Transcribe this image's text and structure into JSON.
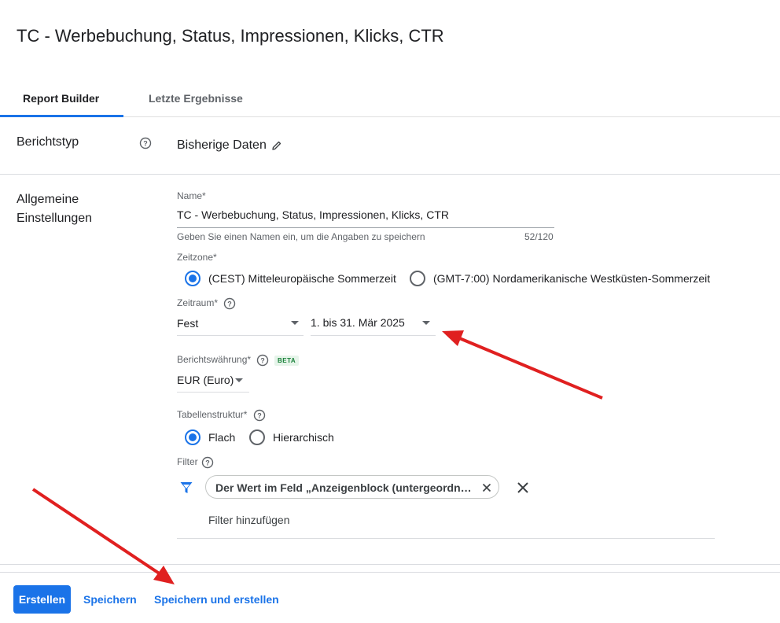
{
  "report": {
    "title": "TC - Werbebuchung, Status, Impressionen, Klicks, CTR"
  },
  "tabs": [
    {
      "label": "Report Builder",
      "active": true
    },
    {
      "label": "Letzte Ergebnisse",
      "active": false
    }
  ],
  "report_type": {
    "section_label": "Berichtstyp",
    "value": "Bisherige Daten",
    "help_icon": "help-circle-icon",
    "edit_icon": "pencil-icon"
  },
  "general": {
    "section_label_line1": "Allgemeine",
    "section_label_line2": "Einstellungen",
    "name": {
      "label": "Name*",
      "value": "TC - Werbebuchung, Status, Impressionen, Klicks, CTR",
      "hint": "Geben Sie einen Namen ein, um die Angaben zu speichern",
      "counter": "52/120"
    },
    "timezone": {
      "label": "Zeitzone*",
      "options": [
        {
          "label": "(CEST) Mitteleuropäische Sommerzeit",
          "selected": true
        },
        {
          "label": "(GMT-7:00) Nordamerikanische Westküsten-Sommerzeit",
          "selected": false
        }
      ]
    },
    "period": {
      "label": "Zeitraum*",
      "type_value": "Fest",
      "range_value": "1. bis 31. Mär 2025"
    },
    "currency": {
      "label": "Berichtswährung*",
      "badge": "BETA",
      "value": "EUR (Euro)"
    },
    "table_structure": {
      "label": "Tabellenstruktur*",
      "options": [
        {
          "label": "Flach",
          "selected": true
        },
        {
          "label": "Hierarchisch",
          "selected": false
        }
      ]
    },
    "filter": {
      "label": "Filter",
      "chip_text": "Der Wert im Feld „Anzeigenblock (untergeordnete …",
      "add_label": "Filter hinzufügen"
    }
  },
  "footer": {
    "create_label": "Erstellen",
    "save_label": "Speichern",
    "save_and_create_label": "Speichern und erstellen"
  },
  "colors": {
    "accent": "#1a73e8",
    "annotation_arrow": "#e02020"
  }
}
